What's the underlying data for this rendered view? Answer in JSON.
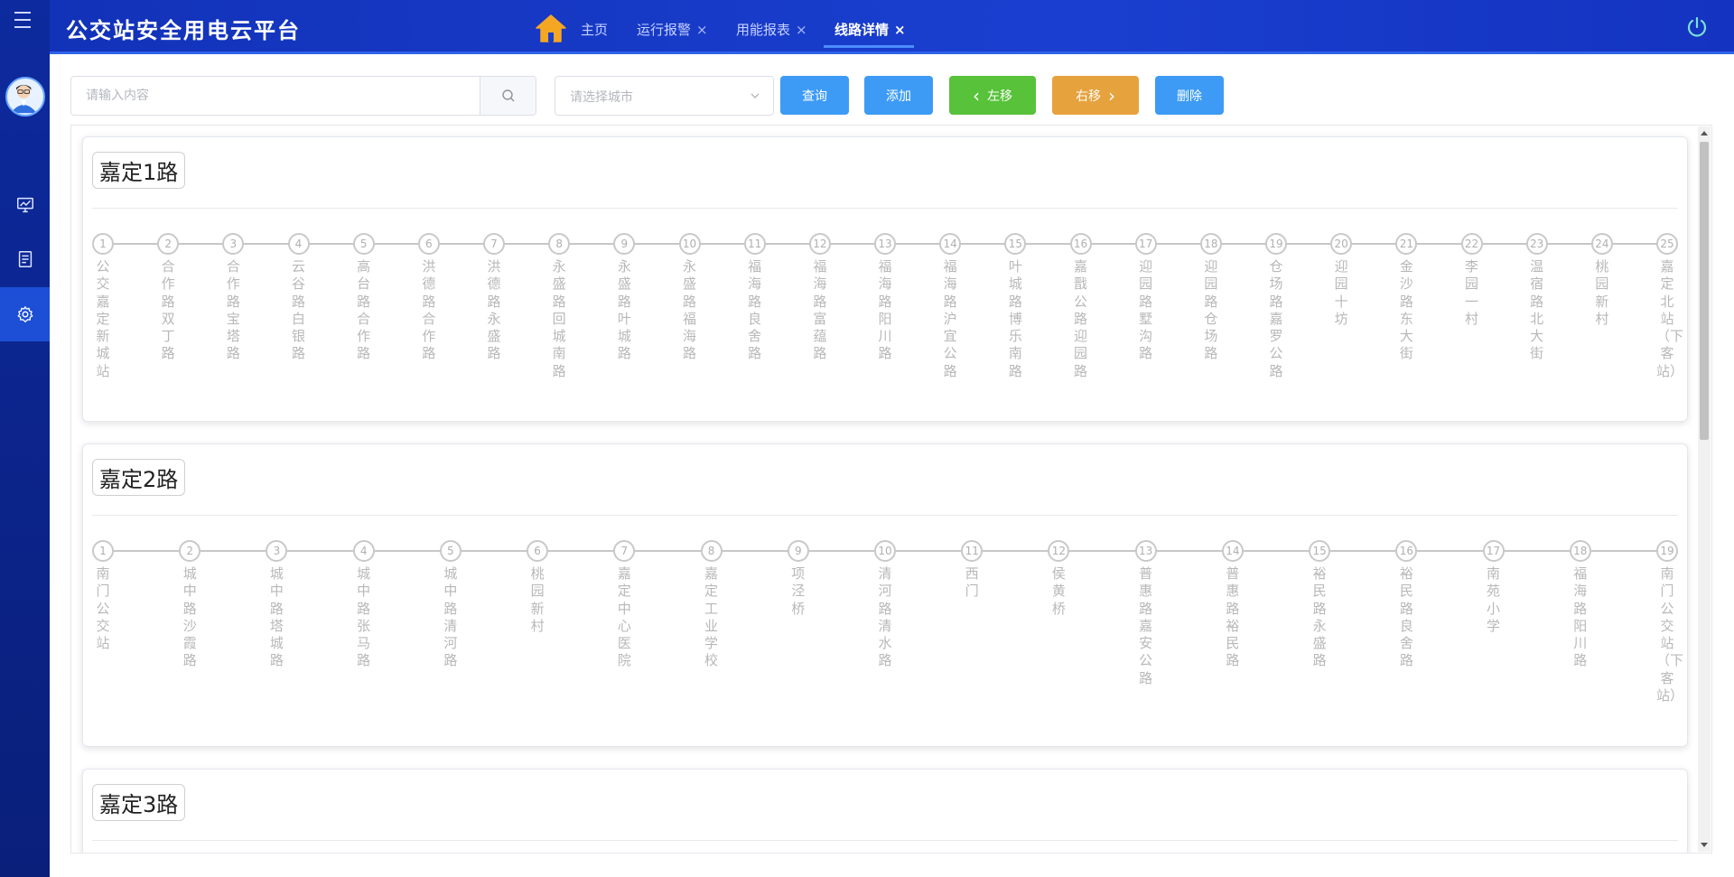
{
  "header": {
    "title": "公交站安全用电云平台",
    "tabs": [
      {
        "label": "主页",
        "closable": false,
        "active": false
      },
      {
        "label": "运行报警",
        "closable": true,
        "active": false
      },
      {
        "label": "用能报表",
        "closable": true,
        "active": false
      },
      {
        "label": "线路详情",
        "closable": true,
        "active": true
      }
    ],
    "close_glyph": "×"
  },
  "toolbar": {
    "search_placeholder": "请输入内容",
    "city_placeholder": "请选择城市",
    "query_label": "查询",
    "add_label": "添加",
    "left_label": "左移",
    "right_label": "右移",
    "delete_label": "删除",
    "left_glyph": "‹",
    "right_glyph": "›"
  },
  "colors": {
    "header_bg": "#1a3fd0",
    "sidebar_bg": "#0d2a9e",
    "btn_blue": "#3d9bf5",
    "btn_green": "#57c23a",
    "btn_orange": "#e6a23c"
  },
  "icons": {
    "menu": "menu-icon",
    "avatar": "avatar-icon",
    "monitor": "monitor-icon",
    "report": "report-icon",
    "settings": "settings-icon",
    "home": "home-icon",
    "power": "power-icon",
    "search": "search-icon",
    "chevron": "chevron-down-icon"
  },
  "routes": [
    {
      "name": "嘉定1路",
      "stations": [
        "公交嘉定新城站",
        "合作路双丁路",
        "合作路宝塔路",
        "云谷路白银路",
        "高台路合作路",
        "洪德路合作路",
        "洪德路永盛路",
        "永盛路回城南路",
        "永盛路叶城路",
        "永盛路福海路",
        "福海路良舍路",
        "福海路富蕴路",
        "福海路阳川路",
        "福海路沪宜公路",
        "叶城路博乐南路",
        "嘉戬公路迎园路",
        "迎园路墅沟路",
        "迎园路仓场路",
        "仓场路嘉罗公路",
        "迎园十坊",
        "金沙路东大街",
        "李园一村",
        "温宿路北大街",
        "桃园新村",
        "嘉定北站（下客站）"
      ]
    },
    {
      "name": "嘉定2路",
      "stations": [
        "南门公交站",
        "城中路沙霞路",
        "城中路塔城路",
        "城中路张马路",
        "城中路清河路",
        "桃园新村",
        "嘉定中心医院",
        "嘉定工业学校",
        "项泾桥",
        "清河路清水路",
        "西门",
        "侯黄桥",
        "普惠路嘉安公路",
        "普惠路裕民路",
        "裕民路永盛路",
        "裕民路良舍路",
        "南苑小学",
        "福海路阳川路",
        "南门公交站（下客站）"
      ]
    },
    {
      "name": "嘉定3路",
      "stations": []
    }
  ]
}
